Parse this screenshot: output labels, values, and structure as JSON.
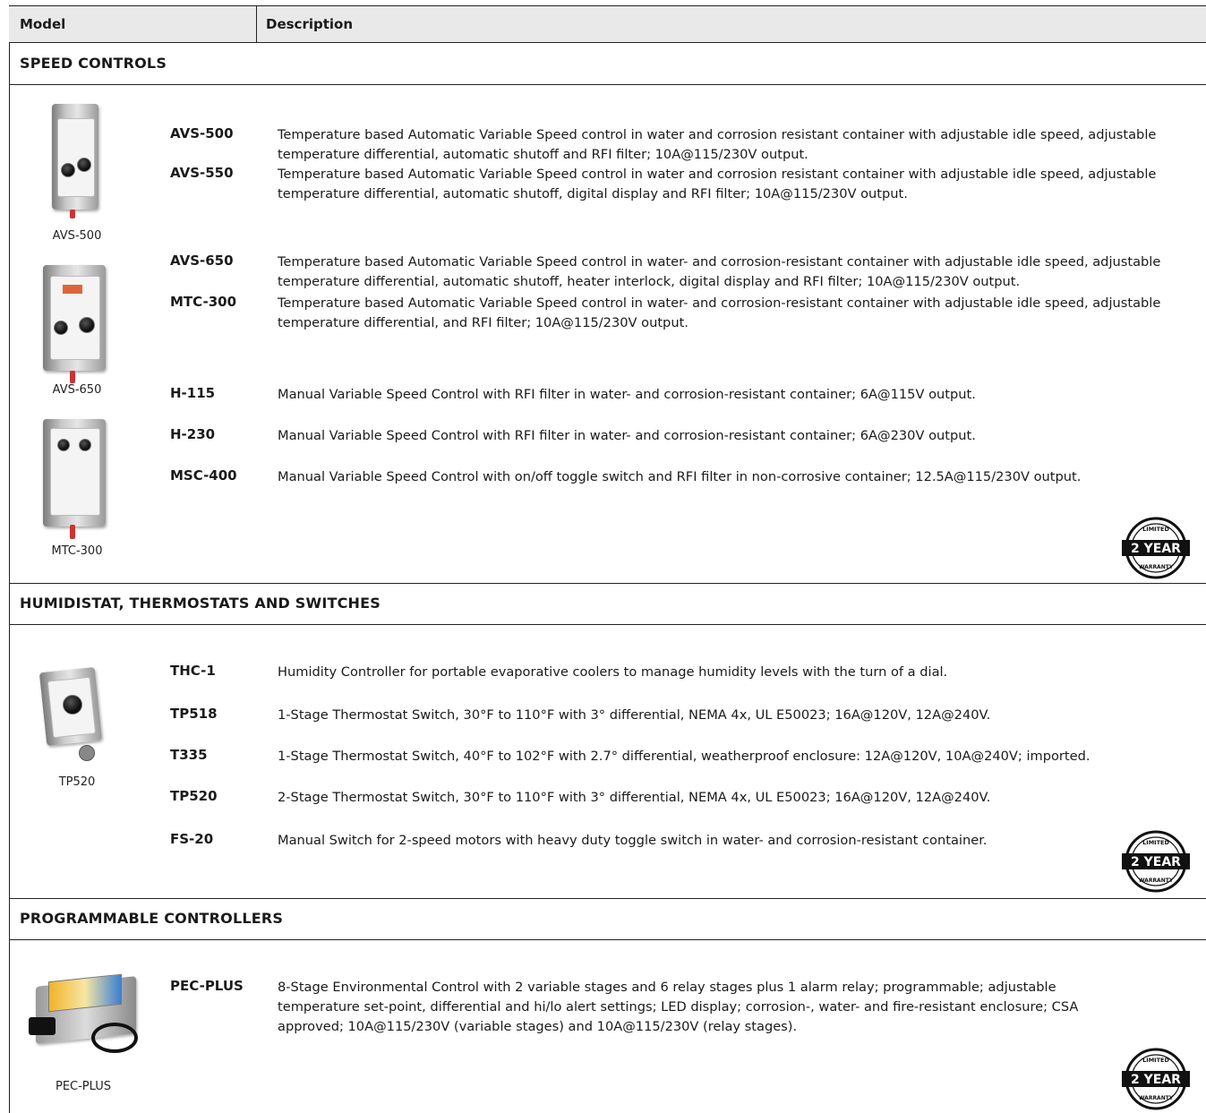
{
  "header": {
    "model": "Model",
    "description": "Description"
  },
  "sections": [
    {
      "title": "SPEED CONTROLS",
      "images": [
        "AVS-500",
        "AVS-650",
        "MTC-300"
      ],
      "rows": [
        {
          "model": "AVS-500",
          "description": "Temperature based Automatic Variable Speed control in water and corrosion resistant container with adjustable idle speed, adjustable temperature differential, automatic shutoff and RFI filter; 10A@115/230V output."
        },
        {
          "model": "AVS-550",
          "description": "Temperature based Automatic Variable Speed control in water and corrosion resistant container with adjustable idle speed, adjustable temperature differential, automatic shutoff, digital display and RFI filter; 10A@115/230V output."
        },
        {
          "model": "AVS-650",
          "description": "Temperature based Automatic Variable Speed control in water- and corrosion-resistant container with adjustable idle speed, adjustable temperature differential, automatic shutoff, heater interlock, digital display and RFI filter; 10A@115/230V output."
        },
        {
          "model": "MTC-300",
          "description": "Temperature based Automatic Variable Speed control in water- and corrosion-resistant container with adjustable idle speed, adjustable temperature differential, and RFI filter; 10A@115/230V output."
        },
        {
          "model": "H-115",
          "description": "Manual Variable Speed Control with RFI filter in water- and corrosion-resistant container; 6A@115V output."
        },
        {
          "model": "H-230",
          "description": "Manual Variable Speed Control with RFI filter in water- and corrosion-resistant container; 6A@230V output."
        },
        {
          "model": "MSC-400",
          "description": "Manual Variable Speed Control with on/off toggle switch and RFI filter in non-corrosive container; 12.5A@115/230V output."
        }
      ],
      "badge": {
        "top": "LIMITED",
        "main": "2 YEAR",
        "bottom": "WARRANTY"
      }
    },
    {
      "title": "HUMIDISTAT, THERMOSTATS AND SWITCHES",
      "images": [
        "TP520"
      ],
      "rows": [
        {
          "model": "THC-1",
          "description": "Humidity Controller for portable evaporative coolers to manage humidity levels with the turn of a dial."
        },
        {
          "model": "TP518",
          "description": "1-Stage Thermostat Switch, 30°F to 110°F with 3° differential, NEMA 4x, UL E50023; 16A@120V, 12A@240V."
        },
        {
          "model": "T335",
          "description": "1-Stage Thermostat Switch, 40°F to 102°F with 2.7° differential, weatherproof enclosure: 12A@120V, 10A@240V; imported."
        },
        {
          "model": "TP520",
          "description": "2-Stage Thermostat Switch, 30°F to 110°F with 3° differential, NEMA 4x, UL E50023; 16A@120V, 12A@240V."
        },
        {
          "model": "FS-20",
          "description": "Manual Switch for 2-speed motors with heavy duty toggle switch in water- and corrosion-resistant container."
        }
      ],
      "badge": {
        "top": "LIMITED",
        "main": "2 YEAR",
        "bottom": "WARRANTY"
      }
    },
    {
      "title": "PROGRAMMABLE CONTROLLERS",
      "images": [
        "PEC-PLUS"
      ],
      "rows": [
        {
          "model": "PEC-PLUS",
          "description": "8-Stage Environmental Control with 2 variable stages and 6 relay stages plus 1 alarm relay; programmable; adjustable temperature set-point, differential and hi/lo alert settings; LED display; corrosion-, water- and fire-resistant enclosure; CSA approved; 10A@115/230V (variable stages) and 10A@115/230V (relay stages)."
        }
      ],
      "badge": {
        "top": "LIMITED",
        "main": "2 YEAR",
        "bottom": "WARRANTY"
      }
    }
  ],
  "colors": {
    "rule": "#222222",
    "header_bg": "#e9e9e9",
    "text": "#1a1a1a"
  }
}
